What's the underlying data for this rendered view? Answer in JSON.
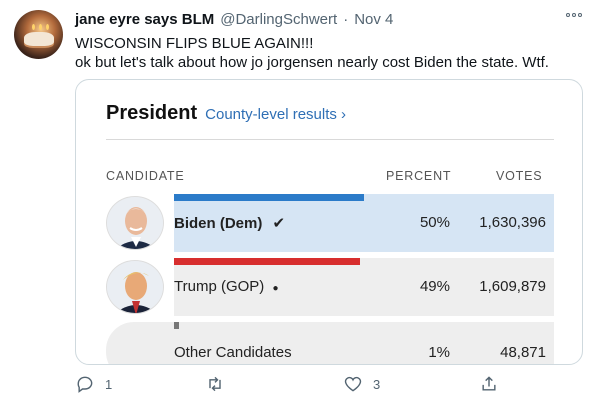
{
  "tweet": {
    "display_name": "jane eyre says BLM",
    "handle": "@DarlingSchwert",
    "separator": "·",
    "date": "Nov 4",
    "text_line1": "WISCONSIN FLIPS BLUE AGAIN!!!",
    "text_line2": "ok but let's talk about how jo jorgensen nearly cost Biden the state. Wtf."
  },
  "card": {
    "title": "President",
    "link": "County-level results ›",
    "headers": {
      "candidate": "CANDIDATE",
      "percent": "PERCENT",
      "votes": "VOTES"
    },
    "rows": [
      {
        "name": "Biden (Dem)",
        "mark": "✔",
        "percent": "50%",
        "votes": "1,630,396",
        "share": 0.5,
        "bar_color": "#2b7bc9",
        "bg_color": "#d6e5f4"
      },
      {
        "name": "Trump (GOP)",
        "mark": "●",
        "percent": "49%",
        "votes": "1,609,879",
        "share": 0.49,
        "bar_color": "#d72e2e",
        "bg_color": "#eeeeee"
      },
      {
        "name": "Other Candidates",
        "mark": "",
        "percent": "1%",
        "votes": "48,871",
        "share": 0.01,
        "bar_color": "#777777",
        "bg_color": "#eeeeee"
      }
    ]
  },
  "actions": {
    "reply_count": "1",
    "retweet_count": "",
    "like_count": "3"
  }
}
